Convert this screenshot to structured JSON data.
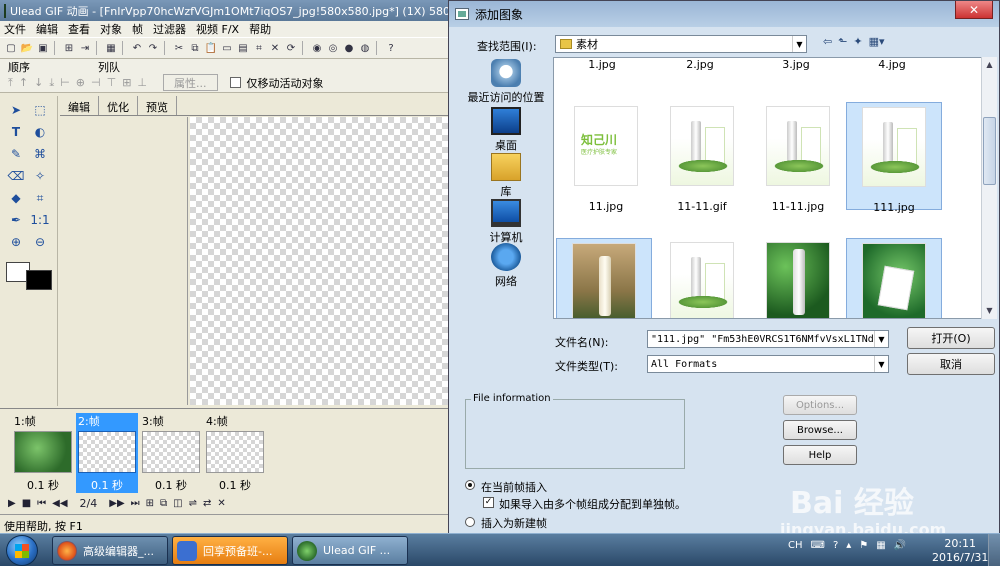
{
  "ulead": {
    "title": "Ulead GIF 动画 - [FnIrVpp70hcWzfVGJm1OMt7iqOS7_jpg!580x580.jpg*] (1X) 580x5",
    "menu": [
      "文件",
      "编辑",
      "查看",
      "对象",
      "帧",
      "过滤器",
      "视频 F/X",
      "帮助"
    ],
    "panel_order_label": "顺序",
    "panel_align_label": "列队",
    "properties_button": "属性...",
    "only_move_active_label": "仅移动活动对象",
    "edit_tabs": [
      "编辑",
      "优化",
      "预览"
    ],
    "frames": [
      {
        "label": "1:帧",
        "delay": "0.1 秒",
        "thumb": "green",
        "selected": false
      },
      {
        "label": "2:帧",
        "delay": "0.1 秒",
        "thumb": "checker",
        "selected": true
      },
      {
        "label": "3:帧",
        "delay": "0.1 秒",
        "thumb": "checker",
        "selected": false
      },
      {
        "label": "4:帧",
        "delay": "0.1 秒",
        "thumb": "checker",
        "selected": false
      }
    ],
    "frame_counter": "2/4",
    "status": "使用帮助, 按 F1"
  },
  "dialog": {
    "title": "添加图象",
    "look_in_label": "查找范围(I):",
    "look_in_value": "素材",
    "places": [
      "最近访问的位置",
      "桌面",
      "库",
      "计算机",
      "网络"
    ],
    "top_row_names": [
      "1.jpg",
      "2.jpg",
      "3.jpg",
      "4.jpg"
    ],
    "files": [
      {
        "name": "11.jpg",
        "kind": "logo",
        "selected": false
      },
      {
        "name": "11-11.gif",
        "kind": "prod",
        "selected": false
      },
      {
        "name": "11-11.jpg",
        "kind": "prod",
        "selected": false
      },
      {
        "name": "111.jpg",
        "kind": "prod",
        "selected": true
      },
      {
        "name": "",
        "kind": "photo1",
        "selected": true
      },
      {
        "name": "",
        "kind": "prod",
        "selected": false
      },
      {
        "name": "",
        "kind": "photo3",
        "selected": false
      },
      {
        "name": "",
        "kind": "photo4",
        "selected": true
      }
    ],
    "logo_text": "知己川",
    "logo_sub": "医疗护肤专家",
    "filename_label": "文件名(N):",
    "filename_value": "\"111.jpg\" \"Fm53hE0VRCS1T6NMfvVsxL1TNdm",
    "filetype_label": "文件类型(T):",
    "filetype_value": "All Formats",
    "open_button": "打开(O)",
    "cancel_button": "取消",
    "options_button": "Options...",
    "browse_button": "Browse...",
    "help_button": "Help",
    "file_info_label": "File information",
    "insert_current_label": "在当前帧插入",
    "split_frames_label": "如果导入由多个帧组成分配到单独帧。",
    "insert_new_label": "插入为新建帧"
  },
  "watermark": {
    "main": "Bai 经验",
    "url": "jingyan.baidu.com"
  },
  "taskbar": {
    "tasks": [
      "高级编辑器_...",
      "回享预备班-...",
      "Ulead GIF ..."
    ],
    "ime": "CH",
    "time": "20:11",
    "date": "2016/7/31"
  },
  "icons": {
    "close": "close-icon",
    "folder": "folder-icon",
    "back": "back-arrow-icon",
    "up": "up-folder-icon",
    "new_folder": "new-folder-icon",
    "views": "view-menu-icon"
  }
}
